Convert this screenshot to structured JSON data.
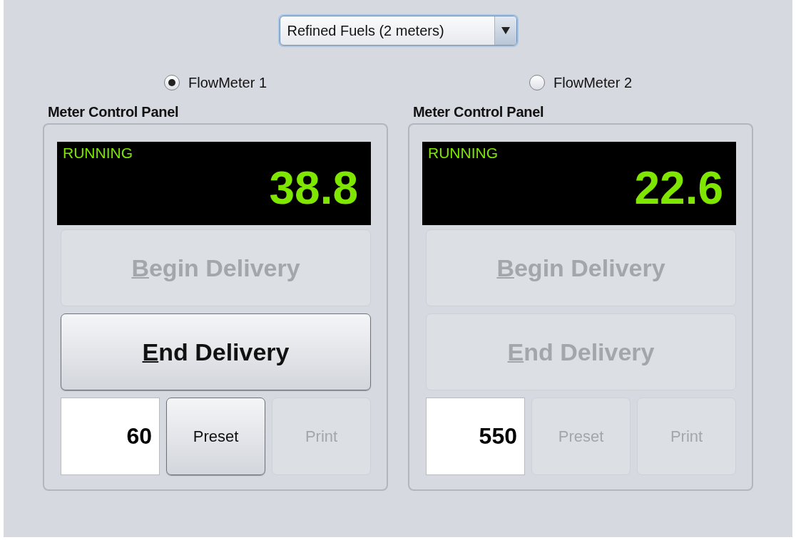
{
  "selector": {
    "value": "Refined Fuels (2 meters)"
  },
  "meters": [
    {
      "label": "FlowMeter 1",
      "selected": true,
      "panel_title": "Meter Control Panel",
      "status": "RUNNING",
      "reading": "38.8",
      "begin_button": {
        "label": "Begin Delivery",
        "disabled": true,
        "mnemonic_first": true
      },
      "end_button": {
        "label": "End Delivery",
        "disabled": false,
        "mnemonic_first": true
      },
      "preset_value": "60",
      "preset_button": {
        "label": "Preset",
        "disabled": false
      },
      "print_button": {
        "label": "Print",
        "disabled": true
      }
    },
    {
      "label": "FlowMeter 2",
      "selected": false,
      "panel_title": "Meter Control Panel",
      "status": "RUNNING",
      "reading": "22.6",
      "begin_button": {
        "label": "Begin Delivery",
        "disabled": true,
        "mnemonic_first": true
      },
      "end_button": {
        "label": "End Delivery",
        "disabled": true,
        "mnemonic_first": true
      },
      "preset_value": "550",
      "preset_button": {
        "label": "Preset",
        "disabled": true
      },
      "print_button": {
        "label": "Print",
        "disabled": true
      }
    }
  ]
}
